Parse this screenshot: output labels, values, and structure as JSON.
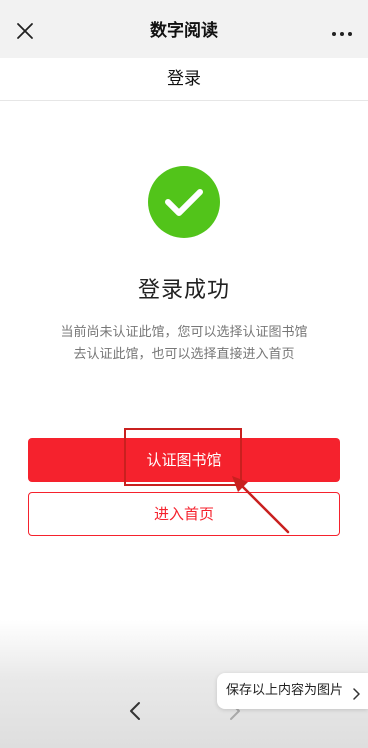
{
  "navbar": {
    "title": "数字阅读",
    "close_icon": "close-icon",
    "more_icon": "more-icon"
  },
  "subheader": {
    "title": "登录"
  },
  "result": {
    "icon": "check-circle-icon",
    "icon_color": "#52c41a",
    "title": "登录成功",
    "description_line1": "当前尚未认证此馆，您可以选择认证图书馆",
    "description_line2": "去认证此馆，也可以选择直接进入首页"
  },
  "actions": {
    "certify_label": "认证图书馆",
    "home_label": "进入首页",
    "accent_color": "#f5222d"
  },
  "bottom": {
    "back_icon": "chevron-left-icon",
    "forward_icon": "chevron-right-icon",
    "save_label": "保存以上内容为图片",
    "save_chevron_icon": "chevron-right-icon"
  }
}
